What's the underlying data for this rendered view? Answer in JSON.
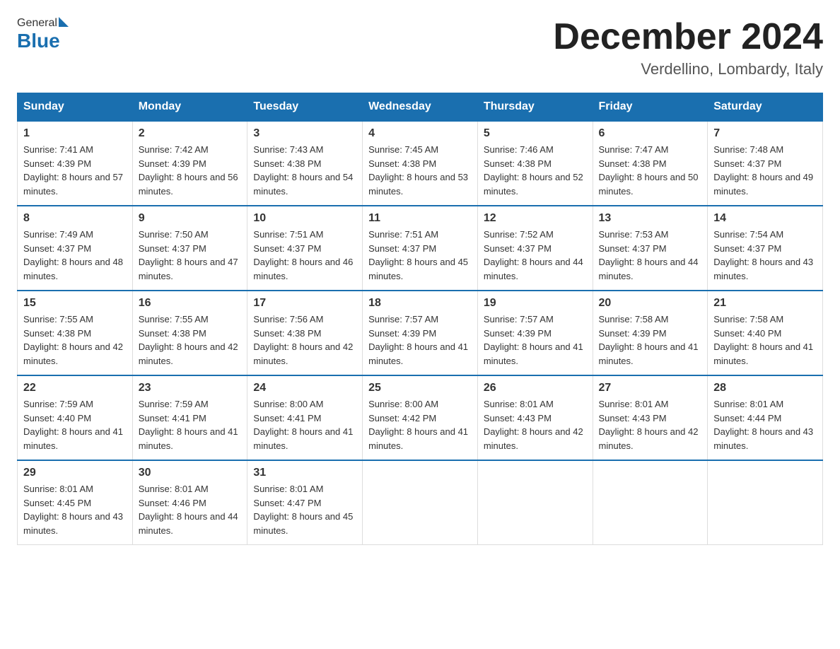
{
  "logo": {
    "general": "General",
    "blue": "Blue"
  },
  "title": {
    "month_year": "December 2024",
    "location": "Verdellino, Lombardy, Italy"
  },
  "headers": [
    "Sunday",
    "Monday",
    "Tuesday",
    "Wednesday",
    "Thursday",
    "Friday",
    "Saturday"
  ],
  "weeks": [
    [
      {
        "day": "1",
        "sunrise": "7:41 AM",
        "sunset": "4:39 PM",
        "daylight": "8 hours and 57 minutes."
      },
      {
        "day": "2",
        "sunrise": "7:42 AM",
        "sunset": "4:39 PM",
        "daylight": "8 hours and 56 minutes."
      },
      {
        "day": "3",
        "sunrise": "7:43 AM",
        "sunset": "4:38 PM",
        "daylight": "8 hours and 54 minutes."
      },
      {
        "day": "4",
        "sunrise": "7:45 AM",
        "sunset": "4:38 PM",
        "daylight": "8 hours and 53 minutes."
      },
      {
        "day": "5",
        "sunrise": "7:46 AM",
        "sunset": "4:38 PM",
        "daylight": "8 hours and 52 minutes."
      },
      {
        "day": "6",
        "sunrise": "7:47 AM",
        "sunset": "4:38 PM",
        "daylight": "8 hours and 50 minutes."
      },
      {
        "day": "7",
        "sunrise": "7:48 AM",
        "sunset": "4:37 PM",
        "daylight": "8 hours and 49 minutes."
      }
    ],
    [
      {
        "day": "8",
        "sunrise": "7:49 AM",
        "sunset": "4:37 PM",
        "daylight": "8 hours and 48 minutes."
      },
      {
        "day": "9",
        "sunrise": "7:50 AM",
        "sunset": "4:37 PM",
        "daylight": "8 hours and 47 minutes."
      },
      {
        "day": "10",
        "sunrise": "7:51 AM",
        "sunset": "4:37 PM",
        "daylight": "8 hours and 46 minutes."
      },
      {
        "day": "11",
        "sunrise": "7:51 AM",
        "sunset": "4:37 PM",
        "daylight": "8 hours and 45 minutes."
      },
      {
        "day": "12",
        "sunrise": "7:52 AM",
        "sunset": "4:37 PM",
        "daylight": "8 hours and 44 minutes."
      },
      {
        "day": "13",
        "sunrise": "7:53 AM",
        "sunset": "4:37 PM",
        "daylight": "8 hours and 44 minutes."
      },
      {
        "day": "14",
        "sunrise": "7:54 AM",
        "sunset": "4:37 PM",
        "daylight": "8 hours and 43 minutes."
      }
    ],
    [
      {
        "day": "15",
        "sunrise": "7:55 AM",
        "sunset": "4:38 PM",
        "daylight": "8 hours and 42 minutes."
      },
      {
        "day": "16",
        "sunrise": "7:55 AM",
        "sunset": "4:38 PM",
        "daylight": "8 hours and 42 minutes."
      },
      {
        "day": "17",
        "sunrise": "7:56 AM",
        "sunset": "4:38 PM",
        "daylight": "8 hours and 42 minutes."
      },
      {
        "day": "18",
        "sunrise": "7:57 AM",
        "sunset": "4:39 PM",
        "daylight": "8 hours and 41 minutes."
      },
      {
        "day": "19",
        "sunrise": "7:57 AM",
        "sunset": "4:39 PM",
        "daylight": "8 hours and 41 minutes."
      },
      {
        "day": "20",
        "sunrise": "7:58 AM",
        "sunset": "4:39 PM",
        "daylight": "8 hours and 41 minutes."
      },
      {
        "day": "21",
        "sunrise": "7:58 AM",
        "sunset": "4:40 PM",
        "daylight": "8 hours and 41 minutes."
      }
    ],
    [
      {
        "day": "22",
        "sunrise": "7:59 AM",
        "sunset": "4:40 PM",
        "daylight": "8 hours and 41 minutes."
      },
      {
        "day": "23",
        "sunrise": "7:59 AM",
        "sunset": "4:41 PM",
        "daylight": "8 hours and 41 minutes."
      },
      {
        "day": "24",
        "sunrise": "8:00 AM",
        "sunset": "4:41 PM",
        "daylight": "8 hours and 41 minutes."
      },
      {
        "day": "25",
        "sunrise": "8:00 AM",
        "sunset": "4:42 PM",
        "daylight": "8 hours and 41 minutes."
      },
      {
        "day": "26",
        "sunrise": "8:01 AM",
        "sunset": "4:43 PM",
        "daylight": "8 hours and 42 minutes."
      },
      {
        "day": "27",
        "sunrise": "8:01 AM",
        "sunset": "4:43 PM",
        "daylight": "8 hours and 42 minutes."
      },
      {
        "day": "28",
        "sunrise": "8:01 AM",
        "sunset": "4:44 PM",
        "daylight": "8 hours and 43 minutes."
      }
    ],
    [
      {
        "day": "29",
        "sunrise": "8:01 AM",
        "sunset": "4:45 PM",
        "daylight": "8 hours and 43 minutes."
      },
      {
        "day": "30",
        "sunrise": "8:01 AM",
        "sunset": "4:46 PM",
        "daylight": "8 hours and 44 minutes."
      },
      {
        "day": "31",
        "sunrise": "8:01 AM",
        "sunset": "4:47 PM",
        "daylight": "8 hours and 45 minutes."
      },
      null,
      null,
      null,
      null
    ]
  ],
  "labels": {
    "sunrise": "Sunrise: ",
    "sunset": "Sunset: ",
    "daylight": "Daylight: "
  }
}
